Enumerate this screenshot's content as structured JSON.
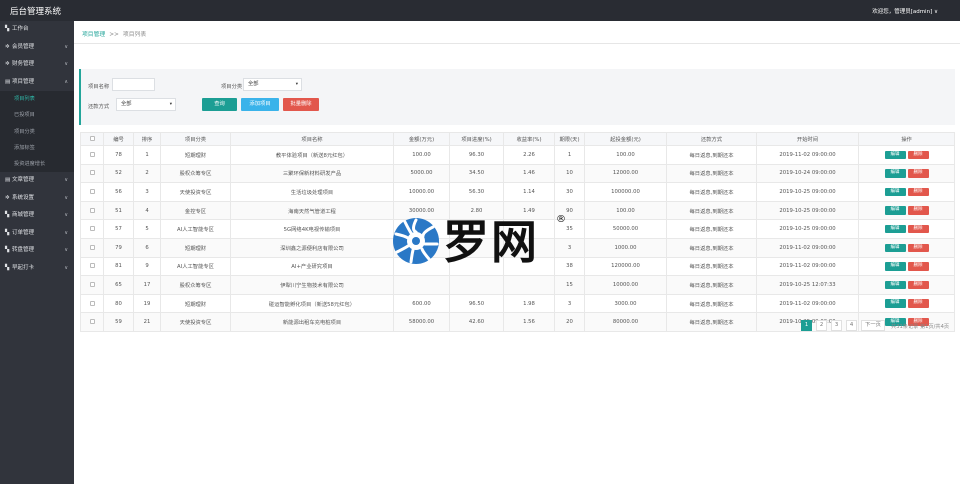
{
  "header": {
    "app_title": "后台管理系统",
    "welcome": "欢迎您，管理员[admin] ∨"
  },
  "sidebar": {
    "items": [
      {
        "icon": "dashboard-icon",
        "label": "工作台",
        "arrow": ""
      },
      {
        "icon": "gear-icon",
        "label": "会员管理",
        "arrow": "∨"
      },
      {
        "icon": "gear-icon",
        "label": "财务管理",
        "arrow": "∨"
      },
      {
        "icon": "list-icon",
        "label": "项目管理",
        "arrow": "∧"
      }
    ],
    "project_sub_items": [
      {
        "label": "项目列表",
        "active": true
      },
      {
        "label": "已投项目",
        "active": false
      },
      {
        "label": "项目分类",
        "active": false
      },
      {
        "label": "添加标签",
        "active": false
      },
      {
        "label": "投资进度增长",
        "active": false
      }
    ],
    "items_after": [
      {
        "icon": "doc-icon",
        "label": "文章管理",
        "arrow": "∨"
      },
      {
        "icon": "gear-icon",
        "label": "系统设置",
        "arrow": "∨"
      },
      {
        "icon": "list-icon",
        "label": "商城管理",
        "arrow": "∨"
      },
      {
        "icon": "list-icon",
        "label": "订单管理",
        "arrow": "∨"
      },
      {
        "icon": "list-icon",
        "label": "转盘管理",
        "arrow": "∨"
      },
      {
        "icon": "list-icon",
        "label": "早起打卡",
        "arrow": "∨"
      }
    ]
  },
  "breadcrumb": {
    "first": "项目管理",
    "separator": ">>",
    "current": "项目列表"
  },
  "filters": {
    "name_label": "项目名称",
    "name_value": "",
    "category_label": "项目分类",
    "category_value": "全部",
    "repay_label": "还款方式",
    "repay_value": "全部",
    "query_button": "查询",
    "add_button": "添加项目",
    "batch_delete_button": "批量删除"
  },
  "table": {
    "columns": [
      "",
      "编号",
      "排序",
      "项目分类",
      "项目名称",
      "金额(万元)",
      "项目进度(%)",
      "收益率(%)",
      "期限(天)",
      "起投金额(元)",
      "还款方式",
      "开始时间",
      "操作"
    ],
    "edit_label": "编辑",
    "delete_label": "删除",
    "rows": [
      [
        "78",
        "1",
        "短期理财",
        "教平体验项目（新送8元红包）",
        "100.00",
        "96.30",
        "2.26",
        "1",
        "100.00",
        "每日返息,到期还本",
        "2019-11-02 09:00:00"
      ],
      [
        "52",
        "2",
        "股权众筹专区",
        "三聚环保新材料研发产品",
        "5000.00",
        "34.50",
        "1.46",
        "10",
        "12000.00",
        "每日返息,到期还本",
        "2019-10-24 09:00:00"
      ],
      [
        "56",
        "3",
        "天使投资专区",
        "生活垃圾处理项目",
        "10000.00",
        "56.30",
        "1.14",
        "30",
        "100000.00",
        "每日返息,到期还本",
        "2019-10-25 09:00:00"
      ],
      [
        "51",
        "4",
        "金控专区",
        "海南天然气管道工程",
        "30000.00",
        "2.80",
        "1.49",
        "90",
        "100.00",
        "每日返息,到期还本",
        "2019-10-25 09:00:00"
      ],
      [
        "57",
        "5",
        "AI人工智能专区",
        "5G网络4K电视传输项目",
        "",
        "",
        "",
        "35",
        "50000.00",
        "每日返息,到期还本",
        "2019-10-25 09:00:00"
      ],
      [
        "79",
        "6",
        "短期理财",
        "深圳鑫之源便利店有限公司",
        "",
        "",
        "",
        "3",
        "1000.00",
        "每日返息,到期还本",
        "2019-11-02 09:00:00"
      ],
      [
        "81",
        "9",
        "AI人工智能专区",
        "AI+产业研究项目",
        "",
        "",
        "",
        "38",
        "120000.00",
        "每日返息,到期还本",
        "2019-11-02 09:00:00"
      ],
      [
        "65",
        "17",
        "股权众筹专区",
        "伊犁川宁生物技术有限公司",
        "",
        "",
        "",
        "15",
        "10000.00",
        "每日返息,到期还本",
        "2019-10-25 12:07:33"
      ],
      [
        "80",
        "19",
        "短期理财",
        "碰运智能孵化项目（新送58元红包）",
        "600.00",
        "96.50",
        "1.98",
        "3",
        "3000.00",
        "每日返息,到期还本",
        "2019-11-02 09:00:00"
      ],
      [
        "59",
        "21",
        "天使投资专区",
        "新能源出租车充电桩项目",
        "58000.00",
        "42.60",
        "1.56",
        "20",
        "80000.00",
        "每日返息,到期还本",
        "2019-10-25 09:00:00"
      ]
    ]
  },
  "pagination": {
    "pages": [
      "1",
      "2",
      "3",
      "4"
    ],
    "next": "下一页",
    "info": "共31条记录 第1页/共4页"
  },
  "watermark": {
    "text": "罗网",
    "reg": "®"
  },
  "colors": {
    "topbar": "#292c33",
    "sidebar": "#31343c",
    "accent": "#1c9e94",
    "add_blue": "#3ab3ea",
    "danger": "#e2574c"
  }
}
